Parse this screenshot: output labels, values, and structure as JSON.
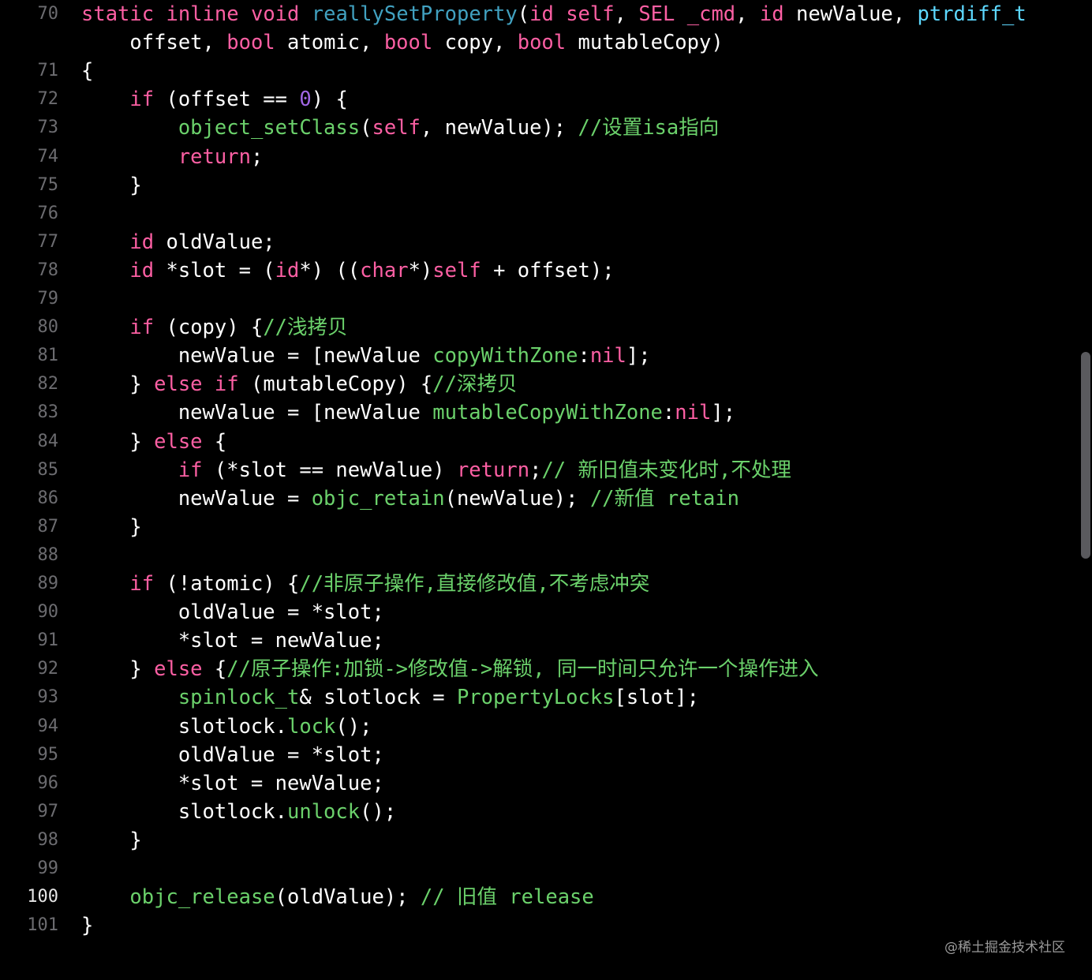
{
  "theme": {
    "background": "#000000",
    "current_line_background": "#202022",
    "line_number_color": "#6c6c70",
    "keyword_color": "#fc5fa3",
    "type_color": "#5dd8ff",
    "function_color": "#41a1c0",
    "number_color": "#a167e6",
    "comment_color": "#6bd16b",
    "plain_color": "#ffffff"
  },
  "editor": {
    "current_line": 100,
    "lines": [
      {
        "num": "70",
        "tokens": [
          [
            "kw",
            "static"
          ],
          [
            "pl",
            " "
          ],
          [
            "kw",
            "inline"
          ],
          [
            "pl",
            " "
          ],
          [
            "kw",
            "void"
          ],
          [
            "pl",
            " "
          ],
          [
            "fn",
            "reallySetProperty"
          ],
          [
            "pl",
            "("
          ],
          [
            "kw",
            "id"
          ],
          [
            "pl",
            " "
          ],
          [
            "kw",
            "self"
          ],
          [
            "pl",
            ", "
          ],
          [
            "kw",
            "SEL"
          ],
          [
            "pl",
            " "
          ],
          [
            "kw",
            "_cmd"
          ],
          [
            "pl",
            ", "
          ],
          [
            "kw",
            "id"
          ],
          [
            "pl",
            " newValue, "
          ],
          [
            "tp",
            "ptrdiff_t"
          ]
        ]
      },
      {
        "num": "",
        "tokens": [
          [
            "pl",
            "    offset, "
          ],
          [
            "kw",
            "bool"
          ],
          [
            "pl",
            " atomic, "
          ],
          [
            "kw",
            "bool"
          ],
          [
            "pl",
            " copy, "
          ],
          [
            "kw",
            "bool"
          ],
          [
            "pl",
            " mutableCopy)"
          ]
        ]
      },
      {
        "num": "71",
        "tokens": [
          [
            "pl",
            "{"
          ]
        ]
      },
      {
        "num": "72",
        "tokens": [
          [
            "pl",
            "    "
          ],
          [
            "kw",
            "if"
          ],
          [
            "pl",
            " (offset == "
          ],
          [
            "ng",
            "0"
          ],
          [
            "pl",
            ") {"
          ]
        ]
      },
      {
        "num": "73",
        "tokens": [
          [
            "pl",
            "        "
          ],
          [
            "cm",
            "object_setClass"
          ],
          [
            "pl",
            "("
          ],
          [
            "kw",
            "self"
          ],
          [
            "pl",
            ", newValue); "
          ],
          [
            "cm",
            "//设置isa指向"
          ]
        ]
      },
      {
        "num": "74",
        "tokens": [
          [
            "pl",
            "        "
          ],
          [
            "kw",
            "return"
          ],
          [
            "pl",
            ";"
          ]
        ]
      },
      {
        "num": "75",
        "tokens": [
          [
            "pl",
            "    }"
          ]
        ]
      },
      {
        "num": "76",
        "tokens": []
      },
      {
        "num": "77",
        "tokens": [
          [
            "pl",
            "    "
          ],
          [
            "kw",
            "id"
          ],
          [
            "pl",
            " oldValue;"
          ]
        ]
      },
      {
        "num": "78",
        "tokens": [
          [
            "pl",
            "    "
          ],
          [
            "kw",
            "id"
          ],
          [
            "pl",
            " *slot = ("
          ],
          [
            "kw",
            "id"
          ],
          [
            "pl",
            "*) (("
          ],
          [
            "kw",
            "char"
          ],
          [
            "pl",
            "*)"
          ],
          [
            "kw",
            "self"
          ],
          [
            "pl",
            " + offset);"
          ]
        ]
      },
      {
        "num": "79",
        "tokens": []
      },
      {
        "num": "80",
        "tokens": [
          [
            "pl",
            "    "
          ],
          [
            "kw",
            "if"
          ],
          [
            "pl",
            " (copy) {"
          ],
          [
            "cm",
            "//浅拷贝"
          ]
        ]
      },
      {
        "num": "81",
        "tokens": [
          [
            "pl",
            "        newValue = [newValue "
          ],
          [
            "cm",
            "copyWithZone"
          ],
          [
            "pl",
            ":"
          ],
          [
            "kw",
            "nil"
          ],
          [
            "pl",
            "];"
          ]
        ]
      },
      {
        "num": "82",
        "tokens": [
          [
            "pl",
            "    } "
          ],
          [
            "kw",
            "else"
          ],
          [
            "pl",
            " "
          ],
          [
            "kw",
            "if"
          ],
          [
            "pl",
            " (mutableCopy) {"
          ],
          [
            "cm",
            "//深拷贝"
          ]
        ]
      },
      {
        "num": "83",
        "tokens": [
          [
            "pl",
            "        newValue = [newValue "
          ],
          [
            "cm",
            "mutableCopyWithZone"
          ],
          [
            "pl",
            ":"
          ],
          [
            "kw",
            "nil"
          ],
          [
            "pl",
            "];"
          ]
        ]
      },
      {
        "num": "84",
        "tokens": [
          [
            "pl",
            "    } "
          ],
          [
            "kw",
            "else"
          ],
          [
            "pl",
            " {"
          ]
        ]
      },
      {
        "num": "85",
        "tokens": [
          [
            "pl",
            "        "
          ],
          [
            "kw",
            "if"
          ],
          [
            "pl",
            " (*slot == newValue) "
          ],
          [
            "kw",
            "return"
          ],
          [
            "pl",
            ";"
          ],
          [
            "cm",
            "// 新旧值未变化时,不处理"
          ]
        ]
      },
      {
        "num": "86",
        "tokens": [
          [
            "pl",
            "        newValue = "
          ],
          [
            "cm",
            "objc_retain"
          ],
          [
            "pl",
            "(newValue); "
          ],
          [
            "cm",
            "//新值 retain"
          ]
        ]
      },
      {
        "num": "87",
        "tokens": [
          [
            "pl",
            "    }"
          ]
        ]
      },
      {
        "num": "88",
        "tokens": []
      },
      {
        "num": "89",
        "tokens": [
          [
            "pl",
            "    "
          ],
          [
            "kw",
            "if"
          ],
          [
            "pl",
            " (!atomic) {"
          ],
          [
            "cm",
            "//非原子操作,直接修改值,不考虑冲突"
          ]
        ]
      },
      {
        "num": "90",
        "tokens": [
          [
            "pl",
            "        oldValue = *slot;"
          ]
        ]
      },
      {
        "num": "91",
        "tokens": [
          [
            "pl",
            "        *slot = newValue;"
          ]
        ]
      },
      {
        "num": "92",
        "tokens": [
          [
            "pl",
            "    } "
          ],
          [
            "kw",
            "else"
          ],
          [
            "pl",
            " {"
          ],
          [
            "cm",
            "//原子操作:加锁->修改值->解锁, 同一时间只允许一个操作进入"
          ]
        ]
      },
      {
        "num": "93",
        "tokens": [
          [
            "pl",
            "        "
          ],
          [
            "cm",
            "spinlock_t"
          ],
          [
            "pl",
            "& slotlock = "
          ],
          [
            "cm",
            "PropertyLocks"
          ],
          [
            "pl",
            "[slot];"
          ]
        ]
      },
      {
        "num": "94",
        "tokens": [
          [
            "pl",
            "        slotlock."
          ],
          [
            "cm",
            "lock"
          ],
          [
            "pl",
            "();"
          ]
        ]
      },
      {
        "num": "95",
        "tokens": [
          [
            "pl",
            "        oldValue = *slot;"
          ]
        ]
      },
      {
        "num": "96",
        "tokens": [
          [
            "pl",
            "        *slot = newValue;"
          ]
        ]
      },
      {
        "num": "97",
        "tokens": [
          [
            "pl",
            "        slotlock."
          ],
          [
            "cm",
            "unlock"
          ],
          [
            "pl",
            "();"
          ]
        ]
      },
      {
        "num": "98",
        "tokens": [
          [
            "pl",
            "    }"
          ]
        ]
      },
      {
        "num": "99",
        "tokens": []
      },
      {
        "num": "100",
        "tokens": [
          [
            "pl",
            "    "
          ],
          [
            "cm",
            "objc_release"
          ],
          [
            "pl",
            "(oldValue); "
          ],
          [
            "cm",
            "// 旧值 release"
          ]
        ]
      },
      {
        "num": "101",
        "tokens": [
          [
            "pl",
            "}"
          ]
        ]
      }
    ]
  },
  "watermark": "@稀土掘金技术社区"
}
